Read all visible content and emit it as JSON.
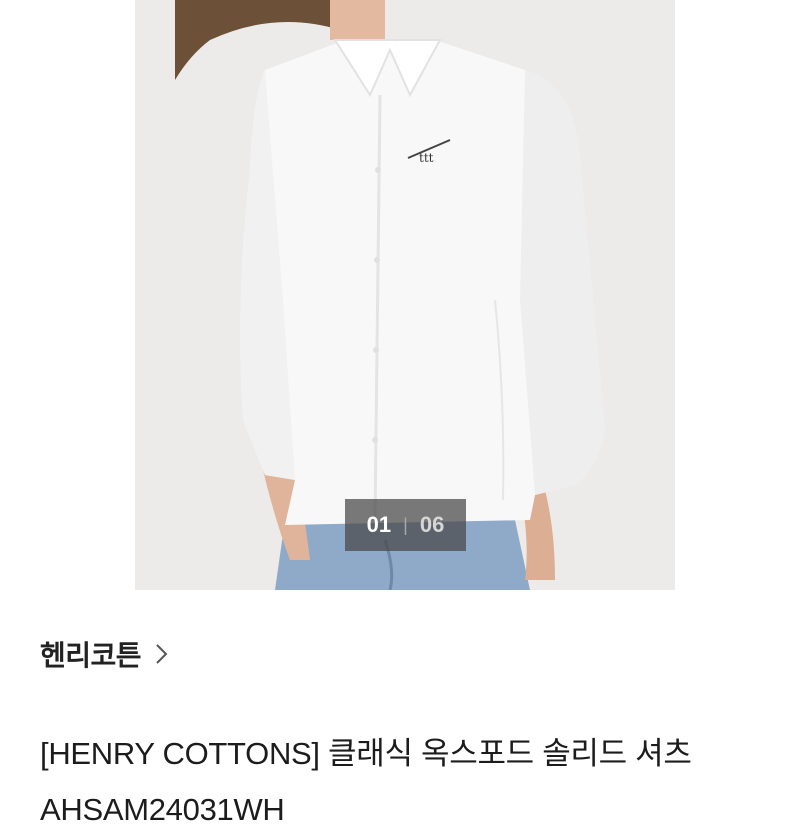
{
  "gallery": {
    "current_index": "01",
    "separator": "|",
    "total_count": "06",
    "image_alt": "white oxford shirt worn by model"
  },
  "product": {
    "brand": "헨리코튼",
    "title": "[HENRY COTTONS] 클래식 옥스포드 솔리드 셔츠 AHSAM24031WH"
  },
  "colors": {
    "photo_background": "#ecebe9",
    "shirt": "#f8f8f8",
    "jeans": "#8fa9c8",
    "text_primary": "#1c1c1c"
  },
  "icons": {
    "brand_link": "chevron-right-icon"
  }
}
